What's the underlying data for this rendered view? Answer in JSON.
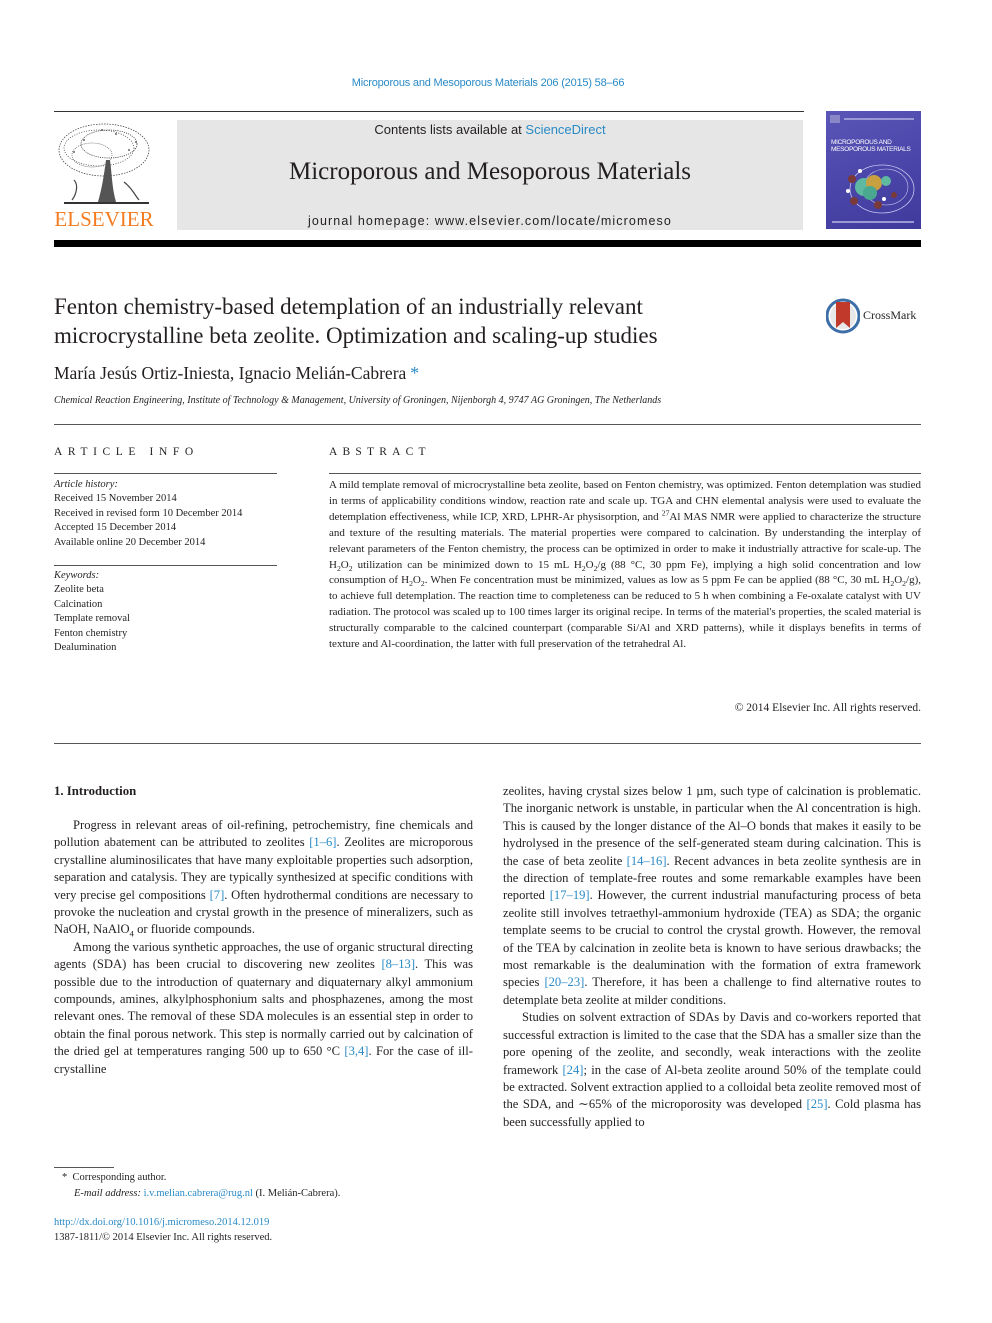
{
  "header": {
    "journal_reference": "Microporous and Mesoporous Materials 206 (2015) 58–66",
    "contents_prefix": "Contents lists available at ",
    "contents_link": "ScienceDirect",
    "journal_title": "Microporous and Mesoporous Materials",
    "homepage_prefix": "journal homepage: ",
    "homepage_url": "www.elsevier.com/locate/micromeso",
    "publisher_wordmark": "ELSEVIER",
    "cover_title": "MICROPOROUS AND MESOPOROUS MATERIALS",
    "brand_color": "#f47b20",
    "link_color": "#2a8ac6"
  },
  "article": {
    "title": "Fenton chemistry-based detemplation of an industrially relevant microcrystalline beta zeolite. Optimization and scaling-up studies",
    "crossmark_label": "CrossMark",
    "authors": "María Jesús Ortiz-Iniesta, Ignacio Melián-Cabrera",
    "author_marker": "*",
    "affiliation": "Chemical Reaction Engineering, Institute of Technology & Management, University of Groningen, Nijenborgh 4, 9747 AG Groningen, The Netherlands"
  },
  "article_info": {
    "heading": "ARTICLE INFO",
    "history_label": "Article history:",
    "history": [
      "Received 15 November 2014",
      "Received in revised form 10 December 2014",
      "Accepted 15 December 2014",
      "Available online 20 December 2014"
    ],
    "keywords_label": "Keywords:",
    "keywords": [
      "Zeolite beta",
      "Calcination",
      "Template removal",
      "Fenton chemistry",
      "Dealumination"
    ]
  },
  "abstract": {
    "heading": "ABSTRACT",
    "parts": {
      "p1": "A mild template removal of microcrystalline beta zeolite, based on Fenton chemistry, was optimized. Fenton detemplation was studied in terms of applicability conditions window, reaction rate and scale up. TGA and CHN elemental analysis were used to evaluate the detemplation effectiveness, while ICP, XRD, LPHR-Ar physisorption, and ",
      "sup27": "27",
      "p2": "Al MAS NMR were applied to characterize the structure and texture of the resulting materials. The material properties were compared to calcination. By understanding the interplay of relevant parameters of the Fenton chemistry, the process can be optimized in order to make it industrially attractive for scale-up. The H",
      "p3": "O",
      "p4": " utilization can be minimized down to 15 mL H",
      "p5": "O",
      "p6": "/g (88 °C, 30 ppm Fe), implying a high solid concentration and low consumption of H",
      "p7": "O",
      "p8": ". When Fe concentration must be minimized, values as low as 5 ppm Fe can be applied (88 °C, 30 mL H",
      "p9": "O",
      "p10": "/g), to achieve full detemplation. The reaction time to completeness can be reduced to 5 h when combining a Fe-oxalate catalyst with UV radiation. The protocol was scaled up to 100 times larger its original recipe. In terms of the material's properties, the scaled material is structurally comparable to the calcined counterpart (comparable Si/Al and XRD patterns), while it displays benefits in terms of texture and Al-coordination, the latter with full preservation of the tetrahedral Al.",
      "sub2": "2"
    },
    "copyright": "© 2014 Elsevier Inc. All rights reserved."
  },
  "introduction": {
    "heading": "1. Introduction",
    "para1": {
      "a": "Progress in relevant areas of oil-refining, petrochemistry, fine chemicals and pollution abatement can be attributed to zeolites ",
      "c1": "[1–6]",
      "b": ". Zeolites are microporous crystalline aluminosilicates that have many exploitable properties such adsorption, separation and catalysis. They are typically synthesized at specific conditions with very precise gel compositions ",
      "c2": "[7]",
      "c": ". Often hydrothermal conditions are necessary to provoke the nucleation and crystal growth in the presence of mineralizers, such as NaOH, NaAlO",
      "sub": "4",
      "d": " or fluoride compounds."
    },
    "para2": {
      "a": "Among the various synthetic approaches, the use of organic structural directing agents (SDA) has been crucial to discovering new zeolites ",
      "c1": "[8–13]",
      "b": ". This was possible due to the introduction of quaternary and diquaternary alkyl ammonium compounds, amines, alkylphosphonium salts and phosphazenes, among the most relevant ones. The removal of these SDA molecules is an essential step in order to obtain the final porous network. This step is normally carried out by calcination of the dried gel at temperatures ranging 500 up to 650 °C ",
      "c2": "[3,4]",
      "c": ". For the case of ill-crystalline"
    },
    "para3": {
      "a": "zeolites, having crystal sizes below 1 µm, such type of calcination is problematic. The inorganic network is unstable, in particular when the Al concentration is high. This is caused by the longer distance of the Al–O bonds that makes it easily to be hydrolysed in the presence of the self-generated steam during calcination. This is the case of beta zeolite ",
      "c1": "[14–16]",
      "b": ". Recent advances in beta zeolite synthesis are in the direction of template-free routes and some remarkable examples have been reported ",
      "c2": "[17–19]",
      "c": ". However, the current industrial manufacturing process of beta zeolite still involves tetraethyl-ammonium hydroxide (TEA) as SDA; the organic template seems to be crucial to control the crystal growth. However, the removal of the TEA by calcination in zeolite beta is known to have serious drawbacks; the most remarkable is the dealumination with the formation of extra framework species ",
      "c3": "[20–23]",
      "d": ". Therefore, it has been a challenge to find alternative routes to detemplate beta zeolite at milder conditions."
    },
    "para4": {
      "a": "Studies on solvent extraction of SDAs by Davis and co-workers reported that successful extraction is limited to the case that the SDA has a smaller size than the pore opening of the zeolite, and secondly, weak interactions with the zeolite framework ",
      "c1": "[24]",
      "b": "; in the case of Al-beta zeolite around 50% of the template could be extracted. Solvent extraction applied to a colloidal beta zeolite removed most of the SDA, and ∼65% of the microporosity was developed ",
      "c2": "[25]",
      "c": ". Cold plasma has been successfully applied to"
    }
  },
  "footnote": {
    "marker": "*",
    "corresponding": "Corresponding author.",
    "email_label": "E-mail address: ",
    "email": "i.v.melian.cabrera@rug.nl",
    "email_suffix": " (I. Melián-Cabrera)."
  },
  "doi": {
    "url": "http://dx.doi.org/10.1016/j.micromeso.2014.12.019",
    "issn_line": "1387-1811/© 2014 Elsevier Inc. All rights reserved."
  }
}
